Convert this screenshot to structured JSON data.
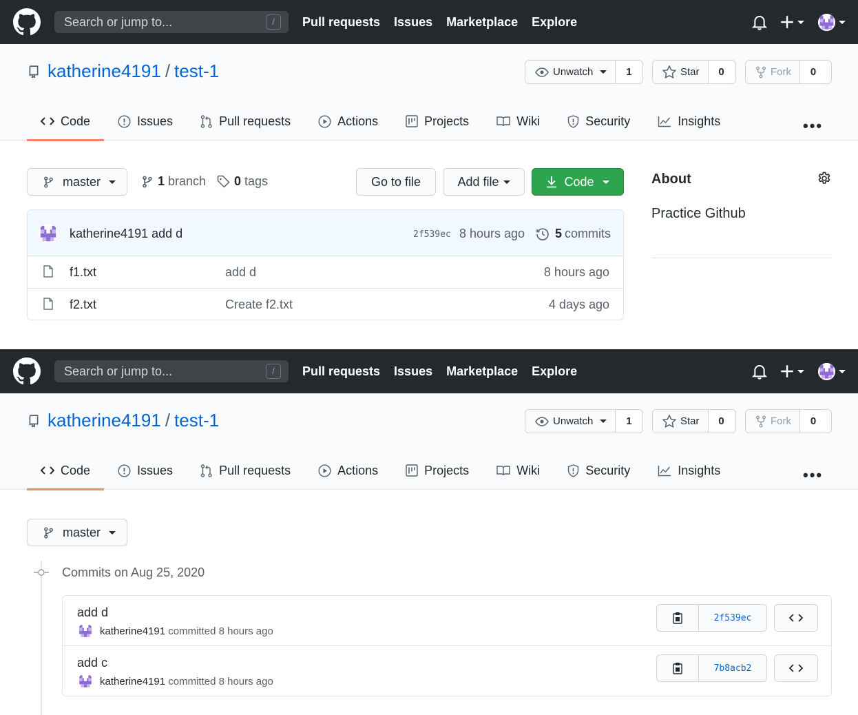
{
  "header": {
    "search_placeholder": "Search or jump to...",
    "slash_key": "/",
    "nav": [
      "Pull requests",
      "Issues",
      "Marketplace",
      "Explore"
    ]
  },
  "repo": {
    "owner": "katherine4191",
    "separator": "/",
    "name": "test-1",
    "watch_label": "Unwatch",
    "watch_count": "1",
    "star_label": "Star",
    "star_count": "0",
    "fork_label": "Fork",
    "fork_count": "0"
  },
  "tabs": [
    "Code",
    "Issues",
    "Pull requests",
    "Actions",
    "Projects",
    "Wiki",
    "Security",
    "Insights"
  ],
  "more_dots": "•••",
  "code_page": {
    "branch": "master",
    "branch_count": "1",
    "branch_label": "branch",
    "tag_count": "0",
    "tag_label": "tags",
    "go_to_file": "Go to file",
    "add_file": "Add file",
    "code_button": "Code",
    "latest_commit": {
      "author": "katherine4191",
      "message": "add d",
      "sha": "2f539ec",
      "time": "8 hours ago",
      "commit_count": "5",
      "commit_label": "commits"
    },
    "files": [
      {
        "name": "f1.txt",
        "message": "add d",
        "age": "8 hours ago"
      },
      {
        "name": "f2.txt",
        "message": "Create f2.txt",
        "age": "4 days ago"
      }
    ],
    "about": {
      "title": "About",
      "description": "Practice Github"
    }
  },
  "commits_page": {
    "branch": "master",
    "date_heading": "Commits on Aug 25, 2020",
    "commits": [
      {
        "title": "add d",
        "author": "katherine4191",
        "verb": "committed",
        "time": "8 hours ago",
        "sha": "2f539ec"
      },
      {
        "title": "add c",
        "author": "katherine4191",
        "verb": "committed",
        "time": "8 hours ago",
        "sha": "7b8acb2"
      }
    ]
  },
  "colors": {
    "header_bg": "#24292e",
    "link": "#0366d6",
    "tab_underline": "#f9826c",
    "code_button": "#2ea44f",
    "commit_bar": "#f1f8ff",
    "avatar": "#8e6bd6"
  }
}
